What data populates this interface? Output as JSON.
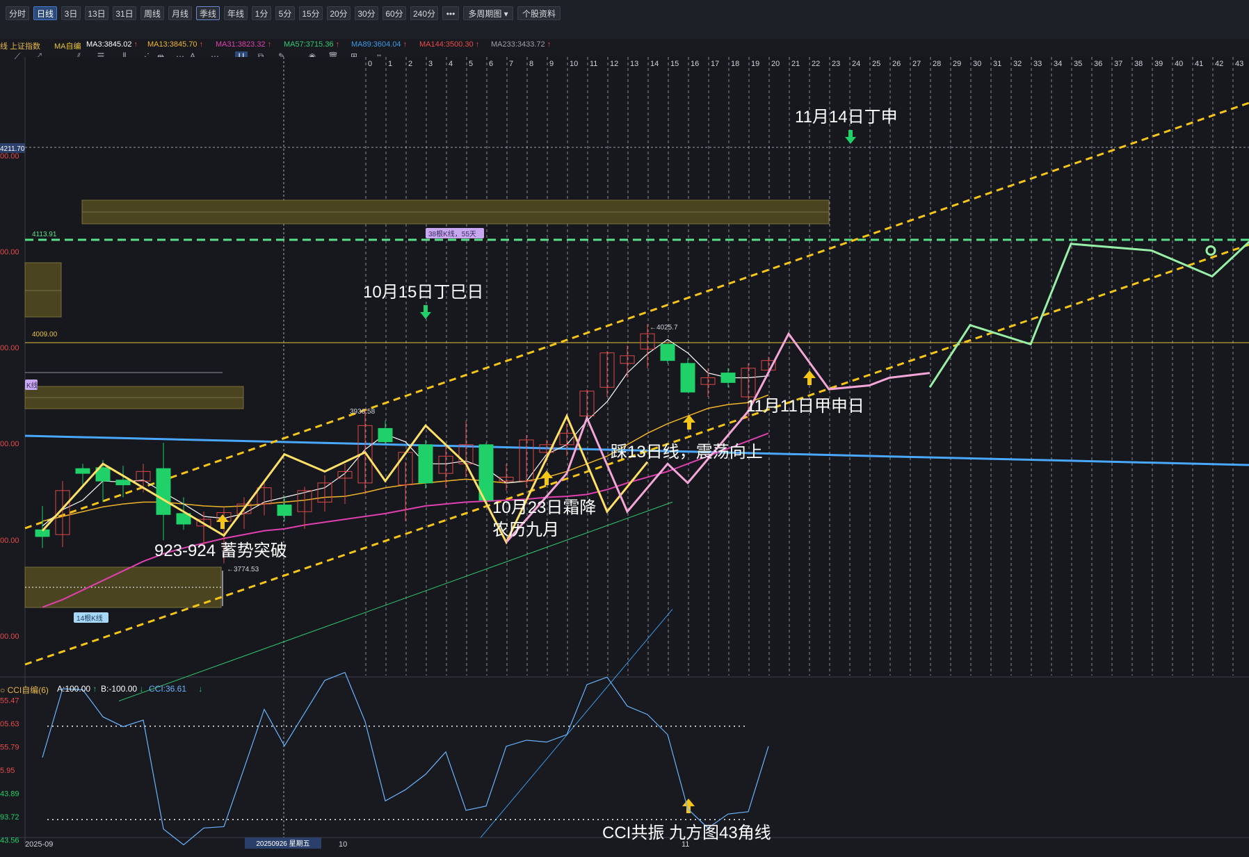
{
  "toolbar": {
    "periods": [
      "分时",
      "日线",
      "3日",
      "13日",
      "31日",
      "周线",
      "月线",
      "季线",
      "年线",
      "1分",
      "5分",
      "15分",
      "20分",
      "30分",
      "60分",
      "240分",
      "•••",
      "多周期图",
      "个股资料"
    ],
    "active": "日线",
    "boxed": "季线",
    "dropdown": "多周期图"
  },
  "drawbar": {
    "icons": [
      "line-tool-icon",
      "ray-tool-icon",
      "parallel-tool-icon",
      "fib-tool-icon",
      "gann-tool-icon",
      "channel-tool-icon",
      "measure-tool-icon",
      "fib-fan-tool-icon",
      "text-tool-icon",
      "more-tools-icon",
      "magnet-icon",
      "copy-icon",
      "pen-icon",
      "eye-icon",
      "trash-icon",
      "layers-icon",
      "ruler-icon"
    ]
  },
  "ma_bar": {
    "index_name": "线 上证指数",
    "items": [
      {
        "label": "MA自编",
        "value": "",
        "color": "#e8c33a",
        "arrow": ""
      },
      {
        "label": "MA3:3845.02",
        "value": "",
        "color": "#ffffff",
        "arrow": "↑"
      },
      {
        "label": "MA13:3845.70",
        "value": "",
        "color": "#f0b429",
        "arrow": "↑"
      },
      {
        "label": "MA31:3823.32",
        "value": "",
        "color": "#e040b0",
        "arrow": "↑"
      },
      {
        "label": "MA57:3715.36",
        "value": "",
        "color": "#2ecc71",
        "arrow": "↑"
      },
      {
        "label": "MA89:3604.04",
        "value": "",
        "color": "#3a9ae8",
        "arrow": "↑"
      },
      {
        "label": "MA144:3500.30",
        "value": "",
        "color": "#e84a4a",
        "arrow": "↑"
      },
      {
        "label": "MA233:3433.72",
        "value": "",
        "color": "#9aa0aa",
        "arrow": "↑"
      }
    ]
  },
  "colors": {
    "up": "#e04848",
    "down": "#1fd168",
    "yellow_wave": "#ffe066",
    "projection": "#98f0a8",
    "channel": "#f5c518",
    "trend_blue": "#4aa8ff"
  },
  "price_axis": {
    "labels": [
      "4211.70",
      "00.00",
      "4113.91",
      "00.00",
      "4009.00",
      "00.00",
      "00.00",
      "00.00",
      "00.00"
    ],
    "cursor_price": "4211.70"
  },
  "time_axis": {
    "labels": [
      "2025-09",
      "10",
      "11"
    ],
    "cursor_date": "20250926 星期五"
  },
  "count_labels": [
    "0",
    "1",
    "2",
    "3",
    "4",
    "5",
    "6",
    "7",
    "8",
    "9",
    "10",
    "11",
    "12",
    "13",
    "14",
    "15",
    "16",
    "17",
    "18",
    "19",
    "20",
    "21",
    "22",
    "23",
    "24",
    "25",
    "26",
    "27",
    "28",
    "29",
    "30",
    "31",
    "32",
    "33",
    "34",
    "35",
    "36",
    "37",
    "38",
    "39",
    "40",
    "41",
    "42",
    "43"
  ],
  "box_labels": {
    "k38": "38根K线，55天",
    "k14": "14根K线",
    "kline": "K线"
  },
  "price_marks": {
    "high": "3936.58",
    "high_arrow": "←",
    "low": "3774.53",
    "low_arrow": "←",
    "peak": "4025.7",
    "peak_arrow": "←",
    "green_level": "4113.91",
    "yellow_level": "4009.00"
  },
  "annotations": {
    "nov14": "11月14日丁申",
    "oct15": "10月15日丁巳日",
    "nov11": "11月11日甲申日",
    "step13": "踩13日线，震荡向上",
    "oct23_line1": "10月23日霜降",
    "oct23_line2": "农历九月",
    "breakout": "923-924 蓄势突破",
    "cci_note": "CCI共振 九方图43角线"
  },
  "cci": {
    "title": "CCI自编(6)",
    "a": "A:100.00",
    "a_arrow": "↑",
    "b": "B:-100.00",
    "b_arrow": "↓",
    "value": "CCI:36.61",
    "value_arrow": "↓",
    "axis_labels": [
      "55.47",
      "05.63",
      "55.79",
      "5.95",
      "43.89",
      "93.72",
      "43.56"
    ],
    "series": [
      33,
      180,
      178,
      120,
      99,
      113,
      -120,
      -154,
      -118,
      -115,
      10,
      136,
      58,
      128,
      198,
      215,
      110,
      -60,
      -36,
      -3,
      45,
      -80,
      -71,
      57,
      70,
      66,
      82,
      189,
      205,
      143,
      125,
      82,
      -77,
      -118,
      -88,
      -83,
      57
    ]
  },
  "candles": [
    {
      "o": 3811,
      "h": 3836,
      "l": 3792,
      "c": 3804
    },
    {
      "o": 3806,
      "h": 3862,
      "l": 3793,
      "c": 3852
    },
    {
      "o": 3875,
      "h": 3880,
      "l": 3858,
      "c": 3870
    },
    {
      "o": 3876,
      "h": 3884,
      "l": 3840,
      "c": 3862
    },
    {
      "o": 3863,
      "h": 3878,
      "l": 3845,
      "c": 3858
    },
    {
      "o": 3862,
      "h": 3880,
      "l": 3850,
      "c": 3872
    },
    {
      "o": 3875,
      "h": 3902,
      "l": 3800,
      "c": 3827
    },
    {
      "o": 3828,
      "h": 3845,
      "l": 3811,
      "c": 3817
    },
    {
      "o": 3815,
      "h": 3830,
      "l": 3790,
      "c": 3822
    },
    {
      "o": 3820,
      "h": 3835,
      "l": 3776,
      "c": 3829
    },
    {
      "o": 3828,
      "h": 3845,
      "l": 3812,
      "c": 3838
    },
    {
      "o": 3838,
      "h": 3862,
      "l": 3826,
      "c": 3855
    },
    {
      "o": 3837,
      "h": 3846,
      "l": 3820,
      "c": 3826
    },
    {
      "o": 3830,
      "h": 3856,
      "l": 3812,
      "c": 3852
    },
    {
      "o": 3840,
      "h": 3868,
      "l": 3830,
      "c": 3860
    },
    {
      "o": 3865,
      "h": 3880,
      "l": 3838,
      "c": 3872
    },
    {
      "o": 3860,
      "h": 3936,
      "l": 3848,
      "c": 3920
    },
    {
      "o": 3917,
      "h": 3925,
      "l": 3900,
      "c": 3903
    },
    {
      "o": 3858,
      "h": 3882,
      "l": 3820,
      "c": 3892
    },
    {
      "o": 3900,
      "h": 3905,
      "l": 3854,
      "c": 3860
    },
    {
      "o": 3870,
      "h": 3900,
      "l": 3855,
      "c": 3888
    },
    {
      "o": 3880,
      "h": 3925,
      "l": 3866,
      "c": 3900
    },
    {
      "o": 3900,
      "h": 3902,
      "l": 3838,
      "c": 3842
    },
    {
      "o": 3862,
      "h": 3880,
      "l": 3852,
      "c": 3866
    },
    {
      "o": 3862,
      "h": 3910,
      "l": 3855,
      "c": 3905
    },
    {
      "o": 3892,
      "h": 3905,
      "l": 3882,
      "c": 3900
    },
    {
      "o": 3900,
      "h": 3922,
      "l": 3888,
      "c": 3912
    },
    {
      "o": 3930,
      "h": 3958,
      "l": 3925,
      "c": 3956
    },
    {
      "o": 3960,
      "h": 3998,
      "l": 3950,
      "c": 3996
    },
    {
      "o": 3985,
      "h": 4004,
      "l": 3970,
      "c": 3993
    },
    {
      "o": 4000,
      "h": 4026,
      "l": 3980,
      "c": 4016
    },
    {
      "o": 4005,
      "h": 4006,
      "l": 3985,
      "c": 3988
    },
    {
      "o": 3985,
      "h": 3990,
      "l": 3955,
      "c": 3955
    },
    {
      "o": 3963,
      "h": 3980,
      "l": 3950,
      "c": 3970
    },
    {
      "o": 3975,
      "h": 3980,
      "l": 3960,
      "c": 3965
    },
    {
      "o": 3950,
      "h": 3985,
      "l": 3925,
      "c": 3980
    },
    {
      "o": 3978,
      "h": 3992,
      "l": 3974,
      "c": 3988
    }
  ],
  "ma3": [
    3815,
    3832,
    3842,
    3862,
    3861,
    3863,
    3850,
    3838,
    3825,
    3823,
    3828,
    3840,
    3845,
    3850,
    3855,
    3870,
    3895,
    3911,
    3903,
    3880,
    3880,
    3883,
    3875,
    3860,
    3862,
    3890,
    3900,
    3925,
    3945,
    3975,
    3995,
    4010,
    3996,
    3975,
    3970,
    3970,
    3972
  ],
  "ma13": [
    3820,
    3825,
    3830,
    3835,
    3838,
    3840,
    3840,
    3838,
    3836,
    3835,
    3836,
    3838,
    3840,
    3842,
    3845,
    3846,
    3850,
    3855,
    3858,
    3860,
    3862,
    3864,
    3862,
    3860,
    3862,
    3866,
    3872,
    3880,
    3888,
    3900,
    3912,
    3922,
    3930,
    3938,
    3942,
    3944,
    3952
  ],
  "ma31": [
    3730,
    3738,
    3748,
    3758,
    3768,
    3778,
    3786,
    3792,
    3797,
    3802,
    3806,
    3810,
    3812,
    3816,
    3819,
    3822,
    3825,
    3828,
    3832,
    3836,
    3838,
    3840,
    3841,
    3842,
    3843,
    3845,
    3846,
    3848,
    3853,
    3860,
    3866,
    3872,
    3880,
    3888,
    3896,
    3904,
    3912
  ],
  "ma57_start": 3632,
  "ma57_end": 3840,
  "ma89_start": 3540,
  "ma89_end": 3728,
  "yellow_wave": [
    [
      0,
      3810
    ],
    [
      3,
      3880
    ],
    [
      9,
      3805
    ],
    [
      12,
      3890
    ],
    [
      14,
      3872
    ],
    [
      16,
      3892
    ],
    [
      17,
      3862
    ],
    [
      19,
      3920
    ],
    [
      21,
      3880
    ],
    [
      23,
      3798
    ],
    [
      26,
      3930
    ],
    [
      28,
      3830
    ],
    [
      30,
      3882
    ]
  ],
  "pink_wave": [
    [
      23,
      3798
    ],
    [
      26,
      3870
    ],
    [
      27,
      3928
    ],
    [
      29,
      3830
    ],
    [
      31,
      3880
    ],
    [
      32,
      3860
    ],
    [
      35,
      3935
    ],
    [
      37,
      4016
    ],
    [
      39,
      3958
    ],
    [
      41,
      3962
    ],
    [
      42,
      3970
    ],
    [
      44,
      3975
    ]
  ],
  "projection": [
    [
      44,
      3960
    ],
    [
      46,
      4025
    ],
    [
      49,
      4005
    ],
    [
      51,
      4110
    ],
    [
      55,
      4103
    ],
    [
      58,
      4076
    ],
    [
      61,
      4135
    ]
  ],
  "projection_dots": [
    [
      58,
      4103
    ],
    [
      62,
      4076
    ]
  ]
}
